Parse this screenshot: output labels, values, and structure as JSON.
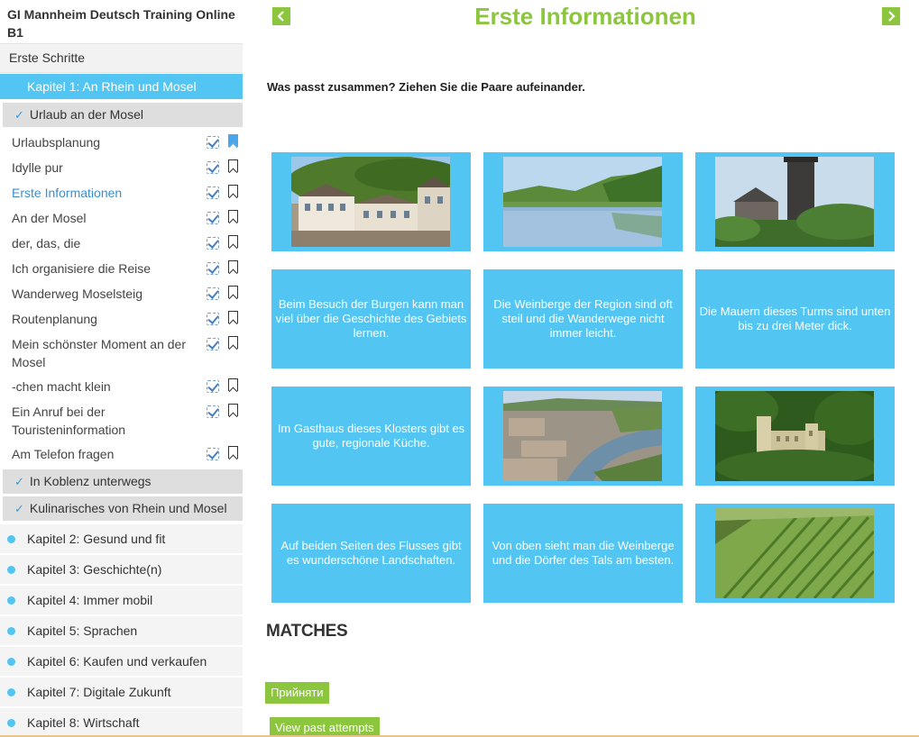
{
  "sidebar": {
    "course_title": "GI Mannheim Deutsch Training Online B1",
    "first_steps": "Erste Schritte",
    "active_chapter": "Kapitel 1: An Rhein und Mosel",
    "section_open": "Urlaub an der Mosel",
    "lessons": [
      {
        "label": "Urlaubsplanung",
        "bookmarked": true
      },
      {
        "label": "Idylle pur"
      },
      {
        "label": "Erste Informationen",
        "current": true
      },
      {
        "label": "An der Mosel"
      },
      {
        "label": "der, das, die"
      },
      {
        "label": "Ich organisiere die Reise"
      },
      {
        "label": "Wanderweg Moselsteig"
      },
      {
        "label": "Routenplanung"
      },
      {
        "label": "Mein schönster Moment an der Mosel"
      },
      {
        "label": "-chen macht klein"
      },
      {
        "label": "Ein Anruf bei der Touristeninformation"
      },
      {
        "label": "Am Telefon fragen"
      }
    ],
    "sections_closed": [
      "In Koblenz unterwegs",
      "Kulinarisches von Rhein und Mosel"
    ],
    "chapters": [
      "Kapitel 2: Gesund und fit",
      "Kapitel 3: Geschichte(n)",
      "Kapitel 4: Immer mobil",
      "Kapitel 5: Sprachen",
      "Kapitel 6: Kaufen und verkaufen",
      "Kapitel 7: Digitale Zukunft",
      "Kapitel 8: Wirtschaft"
    ]
  },
  "main": {
    "title": "Erste Informationen",
    "instruction": "Was passt zusammen? Ziehen Sie die Paare aufeinander.",
    "tiles": [
      {
        "type": "image",
        "name": "monastery-photo"
      },
      {
        "type": "image",
        "name": "river-landscape-photo"
      },
      {
        "type": "image",
        "name": "tower-photo"
      },
      {
        "type": "text",
        "text": "Beim Besuch der Burgen kann man viel über die Geschichte des Gebiets lernen."
      },
      {
        "type": "text",
        "text": "Die Weinberge der Region sind oft steil und die Wanderwege nicht immer leicht."
      },
      {
        "type": "text",
        "text": "Die Mauern dieses Turms sind unten bis zu drei Meter dick."
      },
      {
        "type": "text",
        "text": "Im Gasthaus dieses Klosters gibt es gute, regionale Küche."
      },
      {
        "type": "image",
        "name": "town-aerial-photo"
      },
      {
        "type": "image",
        "name": "castle-photo"
      },
      {
        "type": "text",
        "text": "Auf beiden Seiten des Flusses gibt es wunderschöne Landschaften."
      },
      {
        "type": "text",
        "text": "Von oben sieht man die Weinberge und die Dörfer des Tals am besten."
      },
      {
        "type": "image",
        "name": "vineyard-photo"
      }
    ],
    "matches_label": "MATCHES",
    "accept_label": "Прийняти",
    "past_attempts_label": "View past attempts"
  },
  "colors": {
    "accent_green": "#8cc63f",
    "tile_blue": "#52c5f2",
    "link_blue": "#3a8fd0"
  }
}
